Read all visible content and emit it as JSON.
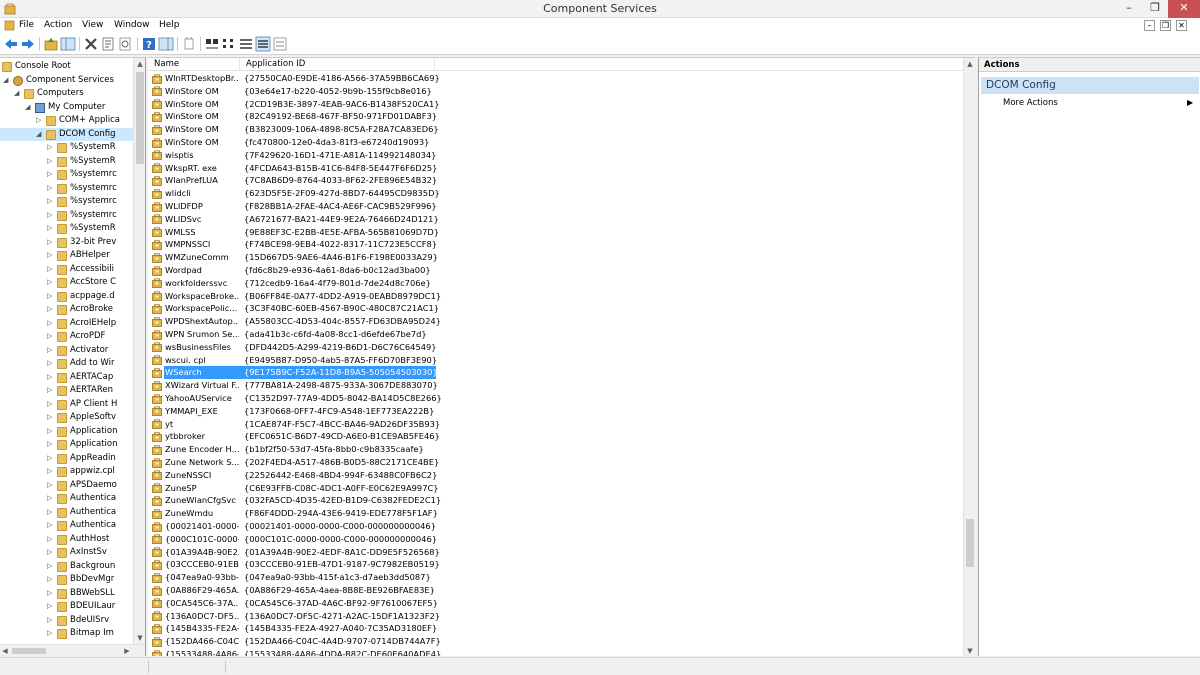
{
  "window": {
    "title": "Component Services",
    "controls": {
      "minimize": "–",
      "restore": "❐",
      "close": "✕"
    }
  },
  "menu": [
    "File",
    "Action",
    "View",
    "Window",
    "Help"
  ],
  "mdi_controls": [
    "–",
    "❐",
    "✕"
  ],
  "tree": {
    "nodes": [
      {
        "label": "Console Root",
        "indent": 0,
        "arrow": "",
        "icon": "folder"
      },
      {
        "label": "Component Services",
        "indent": 1,
        "arrow": "◢",
        "icon": "component"
      },
      {
        "label": "Computers",
        "indent": 2,
        "arrow": "◢",
        "icon": "folder"
      },
      {
        "label": "My Computer",
        "indent": 3,
        "arrow": "◢",
        "icon": "computer"
      },
      {
        "label": "COM+ Applica",
        "indent": 4,
        "arrow": "▷",
        "icon": "folder"
      },
      {
        "label": "DCOM Config",
        "indent": 4,
        "arrow": "◢",
        "icon": "folder",
        "selected": true
      },
      {
        "label": "%SystemR",
        "indent": 5,
        "arrow": "▷",
        "icon": "package"
      },
      {
        "label": "%SystemR",
        "indent": 5,
        "arrow": "▷",
        "icon": "package"
      },
      {
        "label": "%systemrc",
        "indent": 5,
        "arrow": "▷",
        "icon": "package"
      },
      {
        "label": "%systemrc",
        "indent": 5,
        "arrow": "▷",
        "icon": "package"
      },
      {
        "label": "%systemrc",
        "indent": 5,
        "arrow": "▷",
        "icon": "package"
      },
      {
        "label": "%systemrc",
        "indent": 5,
        "arrow": "▷",
        "icon": "package"
      },
      {
        "label": "%SystemR",
        "indent": 5,
        "arrow": "▷",
        "icon": "package"
      },
      {
        "label": "32-bit Prev",
        "indent": 5,
        "arrow": "▷",
        "icon": "package"
      },
      {
        "label": "ABHelper",
        "indent": 5,
        "arrow": "▷",
        "icon": "package"
      },
      {
        "label": "Accessibili",
        "indent": 5,
        "arrow": "▷",
        "icon": "package"
      },
      {
        "label": "AccStore C",
        "indent": 5,
        "arrow": "▷",
        "icon": "package"
      },
      {
        "label": "acppage.d",
        "indent": 5,
        "arrow": "▷",
        "icon": "package"
      },
      {
        "label": "AcroBroke",
        "indent": 5,
        "arrow": "▷",
        "icon": "package"
      },
      {
        "label": "AcroIEHelp",
        "indent": 5,
        "arrow": "▷",
        "icon": "package"
      },
      {
        "label": "AcroPDF",
        "indent": 5,
        "arrow": "▷",
        "icon": "package"
      },
      {
        "label": "Activator",
        "indent": 5,
        "arrow": "▷",
        "icon": "package"
      },
      {
        "label": "Add to Wir",
        "indent": 5,
        "arrow": "▷",
        "icon": "package"
      },
      {
        "label": "AERTACap",
        "indent": 5,
        "arrow": "▷",
        "icon": "package"
      },
      {
        "label": "AERTARen",
        "indent": 5,
        "arrow": "▷",
        "icon": "package"
      },
      {
        "label": "AP Client H",
        "indent": 5,
        "arrow": "▷",
        "icon": "package"
      },
      {
        "label": "AppleSoftv",
        "indent": 5,
        "arrow": "▷",
        "icon": "package"
      },
      {
        "label": "Application",
        "indent": 5,
        "arrow": "▷",
        "icon": "package"
      },
      {
        "label": "Application",
        "indent": 5,
        "arrow": "▷",
        "icon": "package"
      },
      {
        "label": "AppReadin",
        "indent": 5,
        "arrow": "▷",
        "icon": "package"
      },
      {
        "label": "appwiz.cpl",
        "indent": 5,
        "arrow": "▷",
        "icon": "package"
      },
      {
        "label": "APSDaemo",
        "indent": 5,
        "arrow": "▷",
        "icon": "package"
      },
      {
        "label": "Authentica",
        "indent": 5,
        "arrow": "▷",
        "icon": "package"
      },
      {
        "label": "Authentica",
        "indent": 5,
        "arrow": "▷",
        "icon": "package"
      },
      {
        "label": "Authentica",
        "indent": 5,
        "arrow": "▷",
        "icon": "package"
      },
      {
        "label": "AuthHost",
        "indent": 5,
        "arrow": "▷",
        "icon": "package"
      },
      {
        "label": "AxInstSv",
        "indent": 5,
        "arrow": "▷",
        "icon": "package"
      },
      {
        "label": "Backgroun",
        "indent": 5,
        "arrow": "▷",
        "icon": "package"
      },
      {
        "label": "BbDevMgr",
        "indent": 5,
        "arrow": "▷",
        "icon": "package"
      },
      {
        "label": "BBWebSLL",
        "indent": 5,
        "arrow": "▷",
        "icon": "package"
      },
      {
        "label": "BDEUILaur",
        "indent": 5,
        "arrow": "▷",
        "icon": "package"
      },
      {
        "label": "BdeUISrv",
        "indent": 5,
        "arrow": "▷",
        "icon": "package"
      },
      {
        "label": "Bitmap Im",
        "indent": 5,
        "arrow": "▷",
        "icon": "package"
      }
    ]
  },
  "list": {
    "columns": [
      "Name",
      "Application ID"
    ],
    "rows": [
      {
        "name": "WlnRTDesktopBr...",
        "id": "{27550CA0-E9DE-4186-A566-37A59BB6CA69}"
      },
      {
        "name": "WinStore OM",
        "id": "{03e64e17-b220-4052-9b9b-155f9cb8e016}"
      },
      {
        "name": "WinStore OM",
        "id": "{2CD19B3E-3897-4EAB-9AC6-B1438F520CA1}"
      },
      {
        "name": "WinStore OM",
        "id": "{82C49192-BE68-467F-BF50-971FD01DABF3}"
      },
      {
        "name": "WinStore OM",
        "id": "{B3823009-106A-4898-8C5A-F28A7CA83ED6}"
      },
      {
        "name": "WinStore OM",
        "id": "{fc470800-12e0-4da3-81f3-e67240d19093}"
      },
      {
        "name": "wisptis",
        "id": "{7F429620-16D1-471E-A81A-114992148034}"
      },
      {
        "name": "WkspRT. exe",
        "id": "{4FCDA643-B15B-41C6-84F8-5E447F6F6D25}"
      },
      {
        "name": "WlanPrefLUA",
        "id": "{7C8AB6D9-8764-4033-8F62-2FE896E54B32}"
      },
      {
        "name": "wlidcli",
        "id": "{623D5F5E-2F09-427d-8BD7-64495CD9835D}"
      },
      {
        "name": "WLIDFDP",
        "id": "{F828BB1A-2FAE-4AC4-AE6F-CAC9B529F996}"
      },
      {
        "name": "WLIDSvc",
        "id": "{A6721677-BA21-44E9-9E2A-76466D24D121}"
      },
      {
        "name": "WMLSS",
        "id": "{9E88EF3C-E2BB-4E5E-AFBA-565B81069D7D}"
      },
      {
        "name": "WMPNSSCI",
        "id": "{F74BCE98-9EB4-4022-8317-11C723E5CCF8}"
      },
      {
        "name": "WMZuneComm",
        "id": "{15D667D5-9AE6-4A46-B1F6-F198E0033A29}"
      },
      {
        "name": "Wordpad",
        "id": "{fd6c8b29-e936-4a61-8da6-b0c12ad3ba00}"
      },
      {
        "name": "workfolderssvc",
        "id": "{712cedb9-16a4-4f79-801d-7de24d8c706e}"
      },
      {
        "name": "WorkspaceBroke...",
        "id": "{B06FF84E-0A77-4DD2-A919-0EABD8979DC1}"
      },
      {
        "name": "WorkspacePolic...",
        "id": "{3C3F40BC-60EB-4567-B90C-480C87C21AC1}"
      },
      {
        "name": "WPDShextAutop...",
        "id": "{A55803CC-4D53-404c-8557-FD63DBA95D24}"
      },
      {
        "name": "WPN Srumon Se...",
        "id": "{ada41b3c-c6fd-4a08-8cc1-d6efde67be7d}"
      },
      {
        "name": "wsBusinessFiles",
        "id": "{DFD442D5-A299-4219-B6D1-D6C76C64549}"
      },
      {
        "name": "wscui. cpl",
        "id": "{E9495B87-D950-4ab5-87A5-FF6D70BF3E90}"
      },
      {
        "name": "WSearch",
        "id": "{9E175B9C-F52A-11D8-B9A5-505054503030}",
        "selected": true
      },
      {
        "name": "XWizard Virtual F...",
        "id": "{777BA81A-2498-4875-933A-3067DE883070}"
      },
      {
        "name": "YahooAUService",
        "id": "{C1352D97-77A9-4DD5-8042-BA14D5C8E266}"
      },
      {
        "name": "YMMAPI_EXE",
        "id": "{173F0668-0FF7-4FC9-A548-1EF773EA222B}"
      },
      {
        "name": "yt",
        "id": "{1CAE874F-F5C7-4BCC-BA46-9AD26DF35B93}"
      },
      {
        "name": "ytbbroker",
        "id": "{EFC0651C-B6D7-49CD-A6E0-B1CE9AB5FE46}"
      },
      {
        "name": "Zune Encoder H...",
        "id": "{b1bf2f50-53d7-45fa-8bb0-c9b8335caafe}"
      },
      {
        "name": "Zune Network S...",
        "id": "{202F4ED4-A517-486B-B0D5-88C2171CE4BE}"
      },
      {
        "name": "ZuneNSSCI",
        "id": "{22526442-E468-4BD4-994F-63488C0FB6C2}"
      },
      {
        "name": "ZuneSP",
        "id": "{C6E93FFB-C08C-4DC1-A0FF-E0C62E9A997C}"
      },
      {
        "name": "ZuneWlanCfgSvc",
        "id": "{032FA5CD-4D35-42ED-B1D9-C6382FEDE2C1}"
      },
      {
        "name": "ZuneWmdu",
        "id": "{F86F4DDD-294A-43E6-9419-EDE778F5F1AF}"
      },
      {
        "name": "{00021401-0000-...",
        "id": "{00021401-0000-0000-C000-000000000046}"
      },
      {
        "name": "{000C101C-0000-...",
        "id": "{000C101C-0000-0000-C000-000000000046}"
      },
      {
        "name": "{01A39A4B-90E2...",
        "id": "{01A39A4B-90E2-4EDF-8A1C-DD9E5F526568}"
      },
      {
        "name": "{03CCCEB0-91EB...",
        "id": "{03CCCEB0-91EB-47D1-9187-9C7982EB0519}"
      },
      {
        "name": "{047ea9a0-93bb-...",
        "id": "{047ea9a0-93bb-415f-a1c3-d7aeb3dd5087}"
      },
      {
        "name": "{0A886F29-465A...",
        "id": "{0A886F29-465A-4aea-8B8E-BE926BFAE83E}"
      },
      {
        "name": "{0CA545C6-37A...",
        "id": "{0CA545C6-37AD-4A6C-BF92-9F7610067EF5}"
      },
      {
        "name": "{136A0DC7-DF5...",
        "id": "{136A0DC7-DF5C-4271-A2AC-15DF1A1323F2}"
      },
      {
        "name": "{145B4335-FE2A-...",
        "id": "{145B4335-FE2A-4927-A040-7C35AD3180EF}"
      },
      {
        "name": "{152DA466-C04C...",
        "id": "{152DA466-C04C-4A4D-9707-0714DB744A7F}"
      },
      {
        "name": "{15533488-4A86-...",
        "id": "{15533488-4A86-4DDA-B82C-DE60E640ADE4}"
      }
    ]
  },
  "actions": {
    "title": "Actions",
    "section": "DCOM Config",
    "more": "More Actions",
    "more_arrow": "▶"
  },
  "colors": {
    "selection": "#3399ff",
    "section_bg": "#cde3f5",
    "close_btn": "#c75050"
  }
}
